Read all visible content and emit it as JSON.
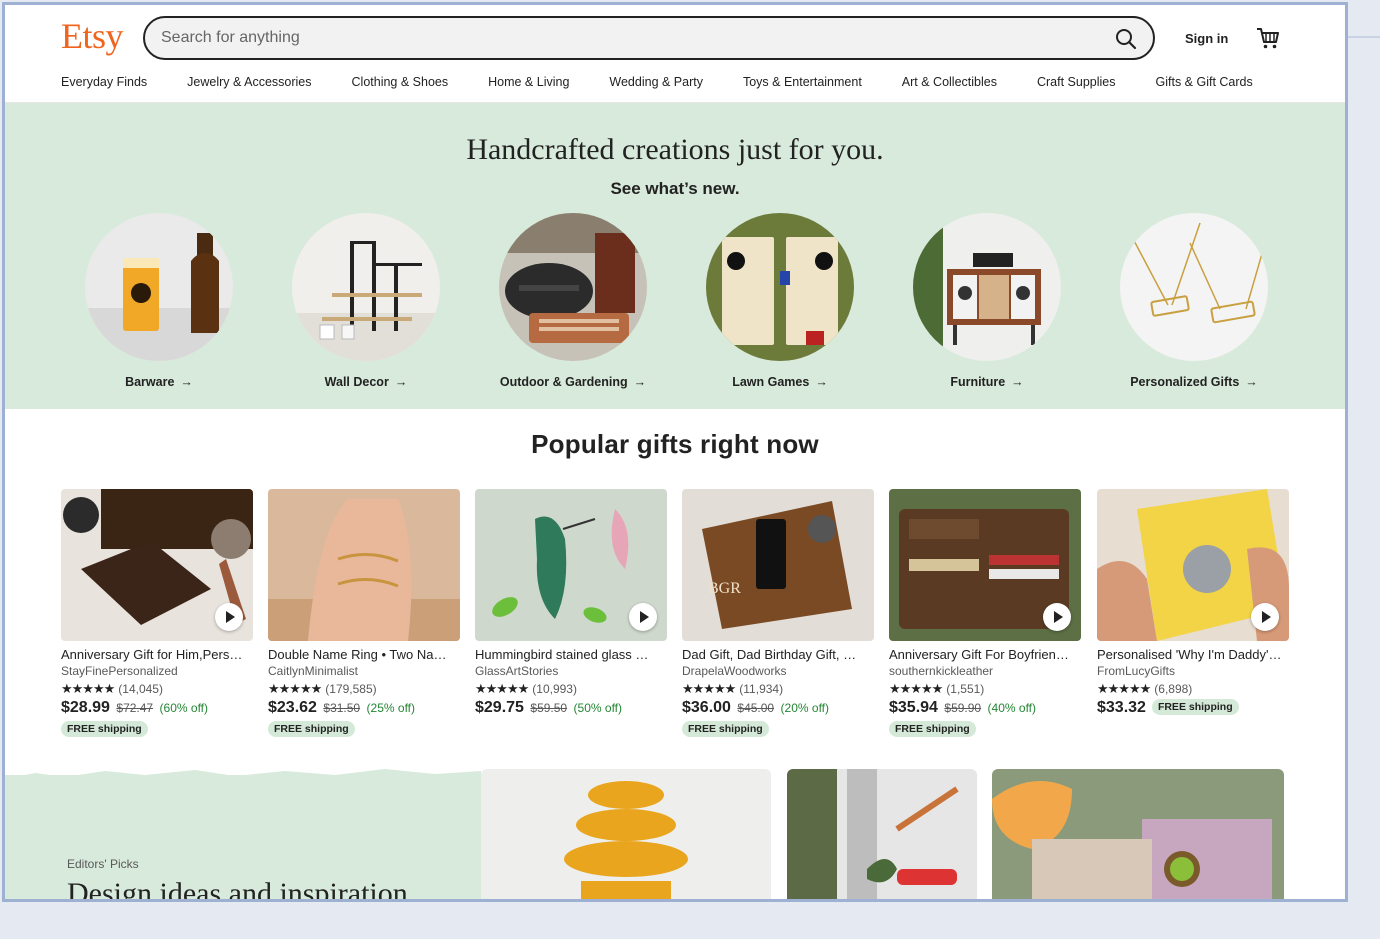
{
  "header": {
    "logo": "Etsy",
    "search_placeholder": "Search for anything",
    "signin_label": "Sign in"
  },
  "nav": [
    "Everyday Finds",
    "Jewelry & Accessories",
    "Clothing & Shoes",
    "Home & Living",
    "Wedding & Party",
    "Toys & Entertainment",
    "Art & Collectibles",
    "Craft Supplies",
    "Gifts & Gift Cards"
  ],
  "hero": {
    "title": "Handcrafted creations just for you.",
    "subtitle": "See what’s new.",
    "categories": [
      {
        "label": "Barware",
        "icon": "beer-glass-image"
      },
      {
        "label": "Wall Decor",
        "icon": "shelf-image"
      },
      {
        "label": "Outdoor & Gardening",
        "icon": "grill-image"
      },
      {
        "label": "Lawn Games",
        "icon": "cornhole-image"
      },
      {
        "label": "Furniture",
        "icon": "record-cabinet-image"
      },
      {
        "label": "Personalized Gifts",
        "icon": "name-necklace-image"
      }
    ]
  },
  "popular": {
    "title": "Popular gifts right now",
    "items": [
      {
        "title": "Anniversary Gift for Him,Pers…",
        "shop": "StayFinePersonalized",
        "stars": "★★★★★",
        "reviews": "(14,045)",
        "price": "$28.99",
        "original": "$72.47",
        "discount": "(60% off)",
        "shipping": "FREE shipping",
        "video": true
      },
      {
        "title": "Double Name Ring • Two Na…",
        "shop": "CaitlynMinimalist",
        "stars": "★★★★★",
        "reviews": "(179,585)",
        "price": "$23.62",
        "original": "$31.50",
        "discount": "(25% off)",
        "shipping": "FREE shipping",
        "video": false
      },
      {
        "title": "Hummingbird stained glass …",
        "shop": "GlassArtStories",
        "stars": "★★★★★",
        "reviews": "(10,993)",
        "price": "$29.75",
        "original": "$59.50",
        "discount": "(50% off)",
        "shipping": "",
        "video": true
      },
      {
        "title": "Dad Gift, Dad Birthday Gift, …",
        "shop": "DrapelaWoodworks",
        "stars": "★★★★★",
        "reviews": "(11,934)",
        "price": "$36.00",
        "original": "$45.00",
        "discount": "(20% off)",
        "shipping": "FREE shipping",
        "video": false
      },
      {
        "title": "Anniversary Gift For Boyfrien…",
        "shop": "southernkickleather",
        "stars": "★★★★★",
        "reviews": "(1,551)",
        "price": "$35.94",
        "original": "$59.90",
        "discount": "(40% off)",
        "shipping": "FREE shipping",
        "video": true
      },
      {
        "title": "Personalised 'Why I'm Daddy'…",
        "shop": "FromLucyGifts",
        "stars": "★★★★★",
        "reviews": "(6,898)",
        "price": "$33.32",
        "original": "",
        "discount": "",
        "shipping": "FREE shipping",
        "video": true
      }
    ]
  },
  "editors": {
    "label": "Editors' Picks",
    "title": "Design ideas and inspiration"
  },
  "colors": {
    "brand": "#f1641e",
    "hero_bg": "#d8eadb",
    "discount_green": "#258635",
    "shipping_badge": "#d4e9d7"
  }
}
